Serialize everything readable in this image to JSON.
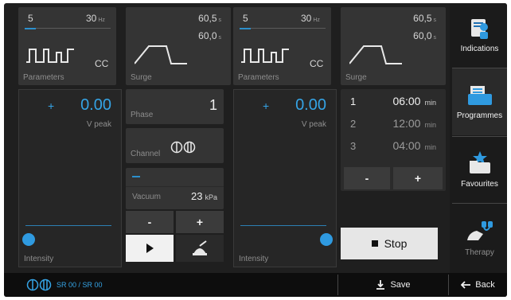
{
  "left_params": {
    "value1": "5",
    "freq": "30",
    "freq_unit": "Hz",
    "mode": "CC",
    "label": "Parameters"
  },
  "left_surge": {
    "time1": "60,5",
    "time1_unit": "s",
    "time2": "60,0",
    "time2_unit": "s",
    "label": "Surge"
  },
  "right_params": {
    "value1": "5",
    "freq": "30",
    "freq_unit": "Hz",
    "mode": "CC",
    "label": "Parameters"
  },
  "right_surge": {
    "time1": "60,5",
    "time1_unit": "s",
    "time2": "60,0",
    "time2_unit": "s",
    "label": "Surge"
  },
  "left_intensity": {
    "plus": "+",
    "value": "0.00",
    "unit": "V peak",
    "label": "Intensity",
    "level": 0
  },
  "right_intensity": {
    "plus": "+",
    "value": "0.00",
    "unit": "V peak",
    "label": "Intensity",
    "level": 1
  },
  "phase": {
    "label": "Phase",
    "value": "1"
  },
  "channel": {
    "label": "Channel"
  },
  "vacuum": {
    "label": "Vacuum",
    "value": "23",
    "unit": "kPa",
    "minus": "-",
    "plus": "+"
  },
  "programme": {
    "rows": [
      {
        "index": "1",
        "time": "06:00",
        "unit": "min"
      },
      {
        "index": "2",
        "time": "12:00",
        "unit": "min"
      },
      {
        "index": "3",
        "time": "04:00",
        "unit": "min"
      }
    ],
    "minus": "-",
    "plus": "+"
  },
  "stop_button": {
    "label": "Stop"
  },
  "sidebar": {
    "items": [
      {
        "label": "Indications"
      },
      {
        "label": "Programmes"
      },
      {
        "label": "Favourites"
      },
      {
        "label": "Therapy"
      }
    ]
  },
  "footer": {
    "status": "SR 00 / SR 00",
    "save": "Save",
    "back": "Back"
  },
  "colors": {
    "accent": "#35a4e6",
    "background": "#1f1f1f",
    "panel": "#343434"
  }
}
